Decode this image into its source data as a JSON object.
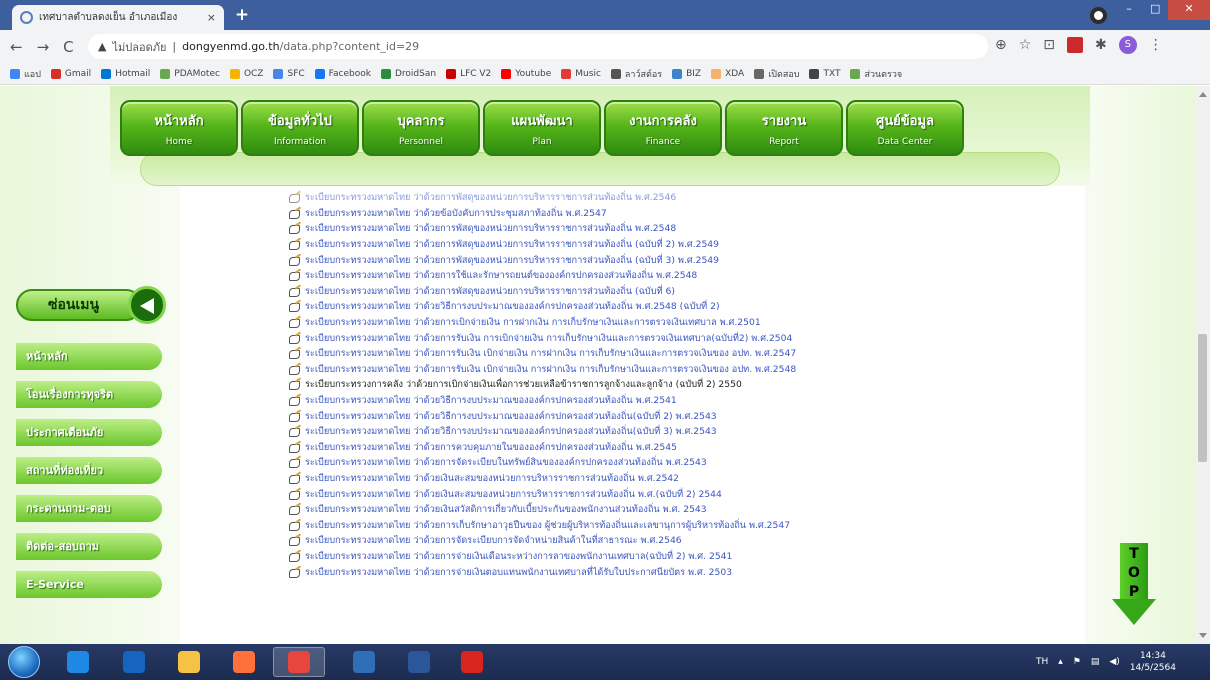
{
  "browser": {
    "tab_title": "เทศบาลตำบลดงเย็น อำเภอเมือง",
    "tab_close": "×",
    "new_tab": "+",
    "window_controls": {
      "minimize": "–",
      "maximize": "□",
      "close": "✕"
    },
    "nav_icons": {
      "back": "←",
      "forward": "→",
      "reload": "C"
    },
    "address": {
      "warning_icon": "▲",
      "security_label": "ไม่ปลอดภัย",
      "separator": "|",
      "domain": "dongyenmd.go.th",
      "path": "/data.php?content_id=29"
    },
    "toolbar_right": {
      "zoom": "⊕",
      "star": "☆",
      "cast": "⊡",
      "extensions": "✱",
      "account_initial": "S",
      "menu": "⋮"
    },
    "bookmarks": [
      {
        "label": "แอป",
        "color": "#4285f4"
      },
      {
        "label": "Gmail",
        "color": "#d93025"
      },
      {
        "label": "Hotmail",
        "color": "#0078d4"
      },
      {
        "label": "PDAMotec",
        "color": "#6aa84f"
      },
      {
        "label": "OCZ",
        "color": "#f4b400"
      },
      {
        "label": "SFC",
        "color": "#4a86e8"
      },
      {
        "label": "Facebook",
        "color": "#1877f2"
      },
      {
        "label": "DroidSan",
        "color": "#2a8f3c"
      },
      {
        "label": "LFC V2",
        "color": "#cc0000"
      },
      {
        "label": "Youtube",
        "color": "#ff0000"
      },
      {
        "label": "Music",
        "color": "#e53935"
      },
      {
        "label": "ลาว์สต์อร",
        "color": "#555555"
      },
      {
        "label": "BIZ",
        "color": "#3d85c6"
      },
      {
        "label": "XDA",
        "color": "#f6b26b"
      },
      {
        "label": "เปิดสอบ",
        "color": "#666666"
      },
      {
        "label": "TXT",
        "color": "#444444"
      },
      {
        "label": "ส่วนตรวจ",
        "color": "#6aa84f"
      }
    ]
  },
  "site": {
    "nav": [
      {
        "th": "หน้าหลัก",
        "en": "Home"
      },
      {
        "th": "ข้อมูลทั่วไป",
        "en": "Information"
      },
      {
        "th": "บุคลากร",
        "en": "Personnel"
      },
      {
        "th": "แผนพัฒนา",
        "en": "Plan"
      },
      {
        "th": "งานการคลัง",
        "en": "Finance"
      },
      {
        "th": "รายงาน",
        "en": "Report"
      },
      {
        "th": "ศูนย์ข้อมูล",
        "en": "Data Center"
      }
    ],
    "menu_heading": "ซ่อนเมนู",
    "side_menu": [
      "หน้าหลัก",
      "โอนเรื่องการทุจริต",
      "ประกาศเตือนภัย",
      "สถานที่ท่องเที่ยว",
      "กระดานถาม-ตอบ",
      "ติดต่อ-สอบถาม",
      "E-Service"
    ],
    "top_button": [
      "T",
      "O",
      "P"
    ],
    "content_items": [
      {
        "text": "ระเบียบกระทรวงมหาดไทย ว่าด้วยการพัสดุของหน่วยการบริหารราชการส่วนท้องถิ่น พ.ศ.2546",
        "style": "partial"
      },
      {
        "text": "ระเบียบกระทรวงมหาดไทย ว่าด้วยข้อบังคับการประชุมสภาท้องถิ่น พ.ศ.2547",
        "style": ""
      },
      {
        "text": "ระเบียบกระทรวงมหาดไทย ว่าด้วยการพัสดุของหน่วยการบริหารราชการส่วนท้องถิ่น พ.ศ.2548",
        "style": ""
      },
      {
        "text": "ระเบียบกระทรวงมหาดไทย ว่าด้วยการพัสดุของหน่วยการบริหารราชการส่วนท้องถิ่น (ฉบับที่ 2) พ.ศ.2549",
        "style": ""
      },
      {
        "text": "ระเบียบกระทรวงมหาดไทย ว่าด้วยการพัสดุของหน่วยการบริหารราชการส่วนท้องถิ่น (ฉบับที่ 3) พ.ศ.2549",
        "style": ""
      },
      {
        "text": "ระเบียบกระทรวงมหาดไทย ว่าด้วยการใช้และรักษารถยนต์ขององค์กรปกครองส่วนท้องถิ่น พ.ศ.2548",
        "style": ""
      },
      {
        "text": "ระเบียบกระทรวงมหาดไทย ว่าด้วยการพัสดุของหน่วยการบริหารราชการส่วนท้องถิ่น (ฉบับที่ 6)",
        "style": ""
      },
      {
        "text": "ระเบียบกระทรวงมหาดไทย ว่าด้วยวิธีการงบประมาณขององค์กรปกครองส่วนท้องถิ่น พ.ศ.2548 (ฉบับที่ 2)",
        "style": ""
      },
      {
        "text": "ระเบียบกระทรวงมหาดไทย ว่าด้วยการเบิกจ่ายเงิน การฝากเงิน การเก็บรักษาเงินและการตรวจเงินเทศบาล พ.ศ.2501",
        "style": ""
      },
      {
        "text": "ระเบียบกระทรวงมหาดไทย ว่าด้วยการรับเงิน การเบิกจ่ายเงิน การเก็บรักษาเงินและการตรวจเงินเทศบาล(ฉบับที่2) พ.ศ.2504",
        "style": ""
      },
      {
        "text": "ระเบียบกระทรวงมหาดไทย ว่าด้วยการรับเงิน เบิกจ่ายเงิน การฝากเงิน การเก็บรักษาเงินและการตรวจเงินของ อปท. พ.ศ.2547",
        "style": ""
      },
      {
        "text": "ระเบียบกระทรวงมหาดไทย ว่าด้วยการรับเงิน เบิกจ่ายเงิน การฝากเงิน การเก็บรักษาเงินและการตรวจเงินของ อปท. พ.ศ.2548",
        "style": ""
      },
      {
        "text": "ระเบียบกระทรวงการคลัง ว่าด้วยการเบิกจ่ายเงินเพื่อการช่วยเหลือข้าราชการลูกจ้างและลูกจ้าง (ฉบับที่ 2) 2550",
        "style": "dark"
      },
      {
        "text": "ระเบียบกระทรวงมหาดไทย ว่าด้วยวิธีการงบประมาณขององค์กรปกครองส่วนท้องถิ่น พ.ศ.2541",
        "style": ""
      },
      {
        "text": "ระเบียบกระทรวงมหาดไทย ว่าด้วยวิธีการงบประมาณขององค์กรปกครองส่วนท้องถิ่น(ฉบับที่ 2) พ.ศ.2543",
        "style": ""
      },
      {
        "text": "ระเบียบกระทรวงมหาดไทย ว่าด้วยวิธีการงบประมาณขององค์กรปกครองส่วนท้องถิ่น(ฉบับที่ 3) พ.ศ.2543",
        "style": ""
      },
      {
        "text": "ระเบียบกระทรวงมหาดไทย ว่าด้วยการควบคุมภายในขององค์กรปกครองส่วนท้องถิ่น พ.ศ.2545",
        "style": ""
      },
      {
        "text": "ระเบียบกระทรวงมหาดไทย ว่าด้วยการจัดระเบียบในทรัพย์สินขององค์กรปกครองส่วนท้องถิ่น พ.ศ.2543",
        "style": ""
      },
      {
        "text": "ระเบียบกระทรวงมหาดไทย ว่าด้วยเงินสะสมของหน่วยการบริหารราชการส่วนท้องถิ่น พ.ศ.2542",
        "style": ""
      },
      {
        "text": "ระเบียบกระทรวงมหาดไทย ว่าด้วยเงินสะสมของหน่วยการบริหารราชการส่วนท้องถิ่น พ.ศ.(ฉบับที่ 2) 2544",
        "style": ""
      },
      {
        "text": "ระเบียบกระทรวงมหาดไทย ว่าด้วยเงินสวัสดิการเกี่ยวกับเบี้ยประกันของพนักงานส่วนท้องถิ่น พ.ศ. 2543",
        "style": ""
      },
      {
        "text": "ระเบียบกระทรวงมหาดไทย ว่าด้วยการเก็บรักษาอาวุธปืนของ ผู้ช่วยผู้บริหารท้องถิ่นและเลขานุการผู้บริหารท้องถิ่น พ.ศ.2547",
        "style": ""
      },
      {
        "text": "ระเบียบกระทรวงมหาดไทย ว่าด้วยการจัดระเบียบการจัดจำหน่ายสินค้าในที่สาธารณะ พ.ศ.2546",
        "style": ""
      },
      {
        "text": "ระเบียบกระทรวงมหาดไทย ว่าด้วยการจ่ายเงินเดือนระหว่างการลาของพนักงานเทศบาล(ฉบับที่ 2) พ.ศ. 2541",
        "style": ""
      },
      {
        "text": "ระเบียบกระทรวงมหาดไทย ว่าด้วยการจ่ายเงินตอบแทนพนักงานเทศบาลที่ได้รับใบประกาศนียบัตร พ.ศ. 2503",
        "style": ""
      }
    ]
  },
  "taskbar": {
    "apps": [
      {
        "name": "ie",
        "color": "#1e88e5"
      },
      {
        "name": "app2",
        "color": "#1565c0"
      },
      {
        "name": "explorer",
        "color": "#f6c244"
      },
      {
        "name": "firefox",
        "color": "#ff7139"
      },
      {
        "name": "chrome",
        "color": "#e8453c"
      },
      {
        "name": "photoshop",
        "color": "#2e6fb7"
      },
      {
        "name": "word",
        "color": "#2b579a"
      },
      {
        "name": "acrobat",
        "color": "#d8261d"
      }
    ],
    "lang": "TH",
    "time": "14:34",
    "date": "14/5/2564"
  }
}
